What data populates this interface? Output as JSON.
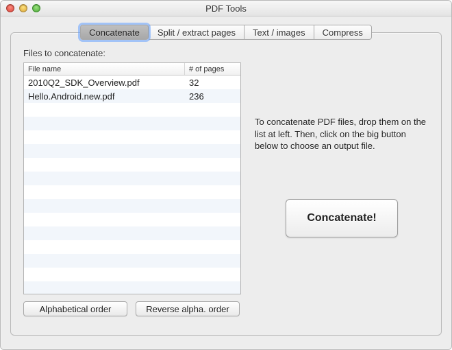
{
  "window": {
    "title": "PDF Tools"
  },
  "tabs": [
    {
      "label": "Concatenate",
      "active": true
    },
    {
      "label": "Split / extract pages",
      "active": false
    },
    {
      "label": "Text / images",
      "active": false
    },
    {
      "label": "Compress",
      "active": false
    }
  ],
  "concatenate": {
    "section_label": "Files to concatenate:",
    "columns": {
      "file_name": "File name",
      "pages": "# of pages"
    },
    "files": [
      {
        "name": "2010Q2_SDK_Overview.pdf",
        "pages": "32"
      },
      {
        "name": "Hello.Android.new.pdf",
        "pages": "236"
      }
    ],
    "visible_rows": 16,
    "buttons": {
      "alpha_order": "Alphabetical order",
      "reverse_alpha": "Reverse alpha. order"
    },
    "instructions": "To concatenate PDF files, drop them on the list at left. Then, click on the big button below to choose an output file.",
    "big_button": "Concatenate!"
  }
}
